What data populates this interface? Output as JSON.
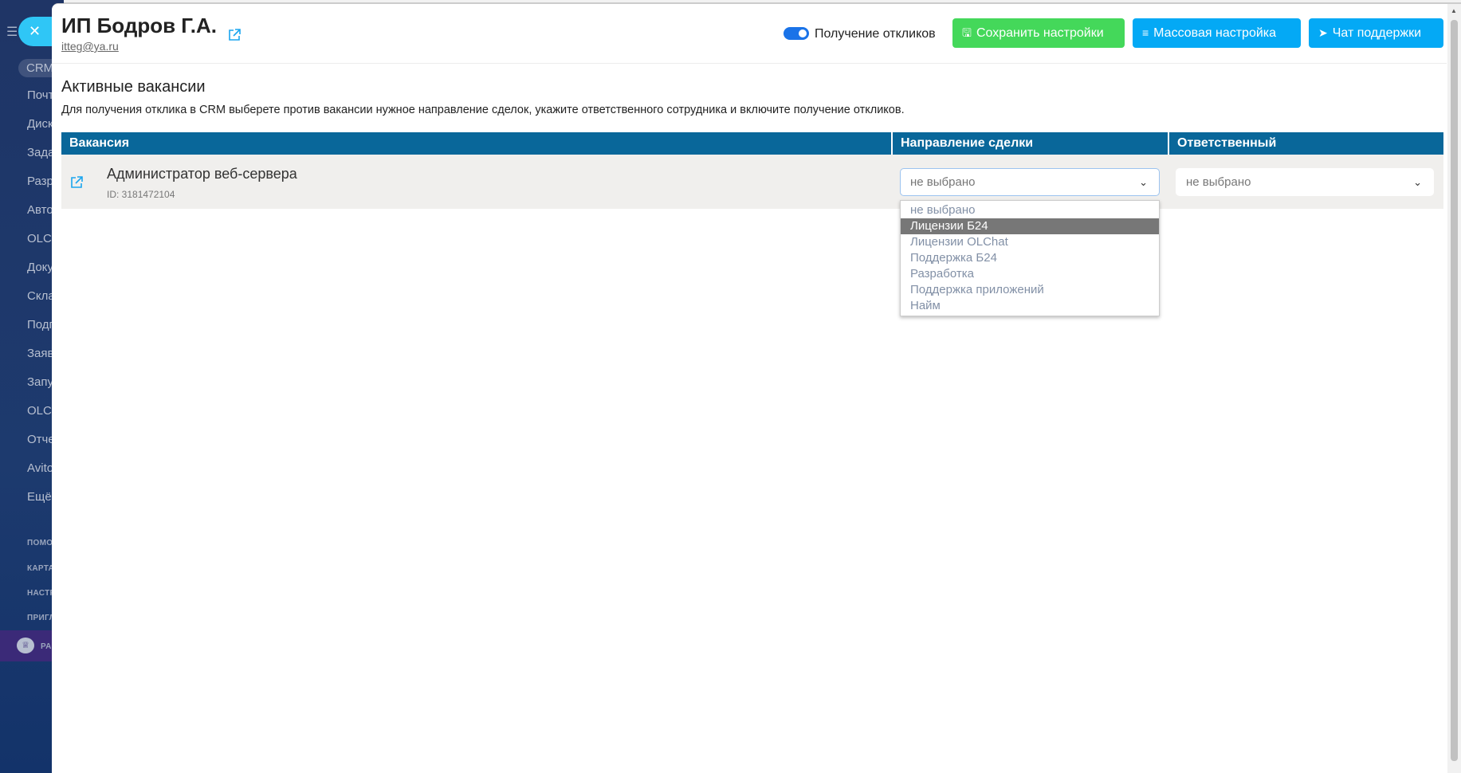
{
  "sidebar": {
    "crm": "CRM",
    "items": [
      "Почт",
      "Диск",
      "Зада",
      "Разр",
      "Авто",
      "OLCh",
      "Доку",
      "Скла",
      "Подп",
      "Заяв",
      "Запу",
      "OLCh",
      "Отче",
      "Avito",
      "Ещё"
    ],
    "small_items": [
      "ПОМО",
      "КАРТА",
      "НАСТР",
      "ПРИГЛ"
    ],
    "promo": "РА"
  },
  "header": {
    "title": "ИП Бодров Г.А.",
    "email": "itteg@ya.ru",
    "toggle_label": "Получение откликов",
    "toggle_on": true,
    "save_label": "Сохранить настройки",
    "mass_label": "Массовая настройка",
    "chat_label": "Чат поддержки"
  },
  "section": {
    "title": "Активные вакансии",
    "description": "Для получения отклика в CRM выберете против вакансии нужное направление сделок, укажите ответственного сотрудника и включите получение откликов."
  },
  "table": {
    "columns": [
      "Вакансия",
      "Направление сделки",
      "Ответственный"
    ],
    "rows": [
      {
        "title": "Администратор веб-сервера",
        "id": "ID: 3181472104",
        "direction": "не выбрано",
        "responsible": "не выбрано"
      }
    ]
  },
  "dropdown": {
    "options": [
      "не выбрано",
      "Лицензии Б24",
      "Лицензии OLChat",
      "Поддержка Б24",
      "Разработка",
      "Поддержка приложений",
      "Найм"
    ],
    "highlighted": "Лицензии Б24"
  },
  "colors": {
    "table_header": "#09679a",
    "save": "#44d85a",
    "blue": "#04a9f5",
    "toggle": "#1a73e8"
  }
}
